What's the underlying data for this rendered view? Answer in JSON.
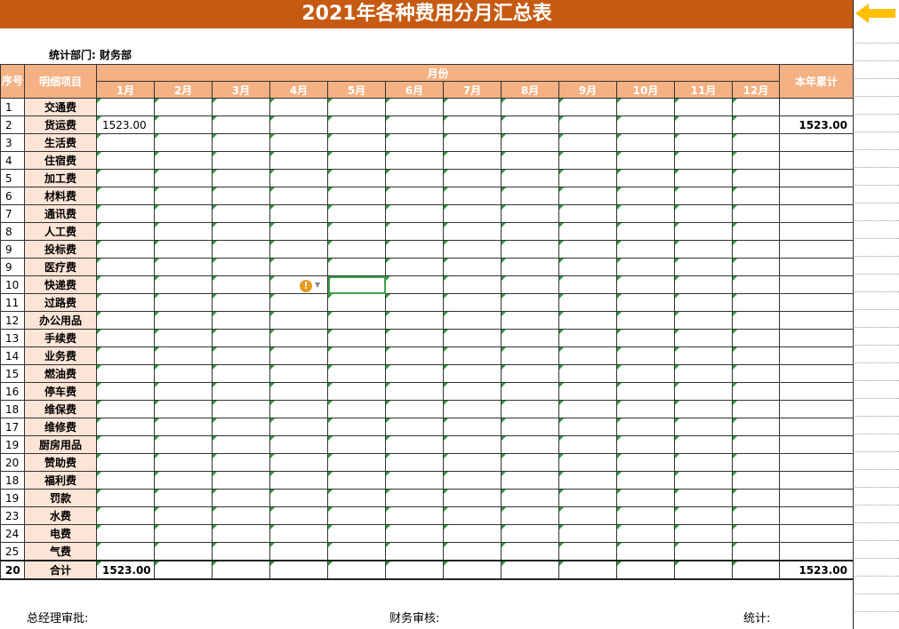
{
  "title": "2021年各种费用分月汇总表",
  "department": "统计部门: 财务部",
  "header": {
    "seq": "序号",
    "item": "明细项目",
    "month_group": "月份",
    "months": [
      "1月",
      "2月",
      "3月",
      "4月",
      "5月",
      "6月",
      "7月",
      "8月",
      "9月",
      "10月",
      "11月",
      "12月"
    ],
    "annual": "本年累计"
  },
  "rows": [
    {
      "seq": "1",
      "item": "交通费",
      "values": [
        "",
        "",
        "",
        "",
        "",
        "",
        "",
        "",
        "",
        "",
        "",
        ""
      ],
      "total": ""
    },
    {
      "seq": "2",
      "item": "货运费",
      "values": [
        "1523.00",
        "",
        "",
        "",
        "",
        "",
        "",
        "",
        "",
        "",
        "",
        ""
      ],
      "total": "1523.00"
    },
    {
      "seq": "3",
      "item": "生活费",
      "values": [
        "",
        "",
        "",
        "",
        "",
        "",
        "",
        "",
        "",
        "",
        "",
        ""
      ],
      "total": ""
    },
    {
      "seq": "4",
      "item": "住宿费",
      "values": [
        "",
        "",
        "",
        "",
        "",
        "",
        "",
        "",
        "",
        "",
        "",
        ""
      ],
      "total": ""
    },
    {
      "seq": "5",
      "item": "加工费",
      "values": [
        "",
        "",
        "",
        "",
        "",
        "",
        "",
        "",
        "",
        "",
        "",
        ""
      ],
      "total": ""
    },
    {
      "seq": "6",
      "item": "材料费",
      "values": [
        "",
        "",
        "",
        "",
        "",
        "",
        "",
        "",
        "",
        "",
        "",
        ""
      ],
      "total": ""
    },
    {
      "seq": "7",
      "item": "通讯费",
      "values": [
        "",
        "",
        "",
        "",
        "",
        "",
        "",
        "",
        "",
        "",
        "",
        ""
      ],
      "total": ""
    },
    {
      "seq": "8",
      "item": "人工费",
      "values": [
        "",
        "",
        "",
        "",
        "",
        "",
        "",
        "",
        "",
        "",
        "",
        ""
      ],
      "total": ""
    },
    {
      "seq": "9",
      "item": "投标费",
      "values": [
        "",
        "",
        "",
        "",
        "",
        "",
        "",
        "",
        "",
        "",
        "",
        ""
      ],
      "total": ""
    },
    {
      "seq": "9",
      "item": "医疗费",
      "values": [
        "",
        "",
        "",
        "",
        "",
        "",
        "",
        "",
        "",
        "",
        "",
        ""
      ],
      "total": ""
    },
    {
      "seq": "10",
      "item": "快递费",
      "values": [
        "",
        "",
        "",
        "",
        "",
        "",
        "",
        "",
        "",
        "",
        "",
        ""
      ],
      "total": ""
    },
    {
      "seq": "11",
      "item": "过路费",
      "values": [
        "",
        "",
        "",
        "",
        "",
        "",
        "",
        "",
        "",
        "",
        "",
        ""
      ],
      "total": ""
    },
    {
      "seq": "12",
      "item": "办公用品",
      "values": [
        "",
        "",
        "",
        "",
        "",
        "",
        "",
        "",
        "",
        "",
        "",
        ""
      ],
      "total": ""
    },
    {
      "seq": "13",
      "item": "手续费",
      "values": [
        "",
        "",
        "",
        "",
        "",
        "",
        "",
        "",
        "",
        "",
        "",
        ""
      ],
      "total": ""
    },
    {
      "seq": "14",
      "item": "业务费",
      "values": [
        "",
        "",
        "",
        "",
        "",
        "",
        "",
        "",
        "",
        "",
        "",
        ""
      ],
      "total": ""
    },
    {
      "seq": "15",
      "item": "燃油费",
      "values": [
        "",
        "",
        "",
        "",
        "",
        "",
        "",
        "",
        "",
        "",
        "",
        ""
      ],
      "total": ""
    },
    {
      "seq": "16",
      "item": "停车费",
      "values": [
        "",
        "",
        "",
        "",
        "",
        "",
        "",
        "",
        "",
        "",
        "",
        ""
      ],
      "total": ""
    },
    {
      "seq": "18",
      "item": "维保费",
      "values": [
        "",
        "",
        "",
        "",
        "",
        "",
        "",
        "",
        "",
        "",
        "",
        ""
      ],
      "total": ""
    },
    {
      "seq": "17",
      "item": "维修费",
      "values": [
        "",
        "",
        "",
        "",
        "",
        "",
        "",
        "",
        "",
        "",
        "",
        ""
      ],
      "total": ""
    },
    {
      "seq": "19",
      "item": "厨房用品",
      "values": [
        "",
        "",
        "",
        "",
        "",
        "",
        "",
        "",
        "",
        "",
        "",
        ""
      ],
      "total": ""
    },
    {
      "seq": "20",
      "item": "赞助费",
      "values": [
        "",
        "",
        "",
        "",
        "",
        "",
        "",
        "",
        "",
        "",
        "",
        ""
      ],
      "total": ""
    },
    {
      "seq": "18",
      "item": "福利费",
      "values": [
        "",
        "",
        "",
        "",
        "",
        "",
        "",
        "",
        "",
        "",
        "",
        ""
      ],
      "total": ""
    },
    {
      "seq": "19",
      "item": "罚款",
      "values": [
        "",
        "",
        "",
        "",
        "",
        "",
        "",
        "",
        "",
        "",
        "",
        ""
      ],
      "total": ""
    },
    {
      "seq": "23",
      "item": "水费",
      "values": [
        "",
        "",
        "",
        "",
        "",
        "",
        "",
        "",
        "",
        "",
        "",
        ""
      ],
      "total": ""
    },
    {
      "seq": "24",
      "item": "电费",
      "values": [
        "",
        "",
        "",
        "",
        "",
        "",
        "",
        "",
        "",
        "",
        "",
        ""
      ],
      "total": ""
    },
    {
      "seq": "25",
      "item": "气费",
      "values": [
        "",
        "",
        "",
        "",
        "",
        "",
        "",
        "",
        "",
        "",
        "",
        ""
      ],
      "total": ""
    }
  ],
  "total_row": {
    "seq": "20",
    "item": "合计",
    "values": [
      "1523.00",
      "",
      "",
      "",
      "",
      "",
      "",
      "",
      "",
      "",
      "",
      ""
    ],
    "total": "1523.00"
  },
  "footer": {
    "approve": "总经理审批:",
    "finance": "财务审核:",
    "stat": "统计:"
  },
  "warning_icon": "exclamation-icon",
  "colors": {
    "title_bg": "#c65a11",
    "header_bg": "#f4b183",
    "item_bg": "#fce4d6",
    "arrow": "#ffc000",
    "selection": "#3aa34a"
  }
}
